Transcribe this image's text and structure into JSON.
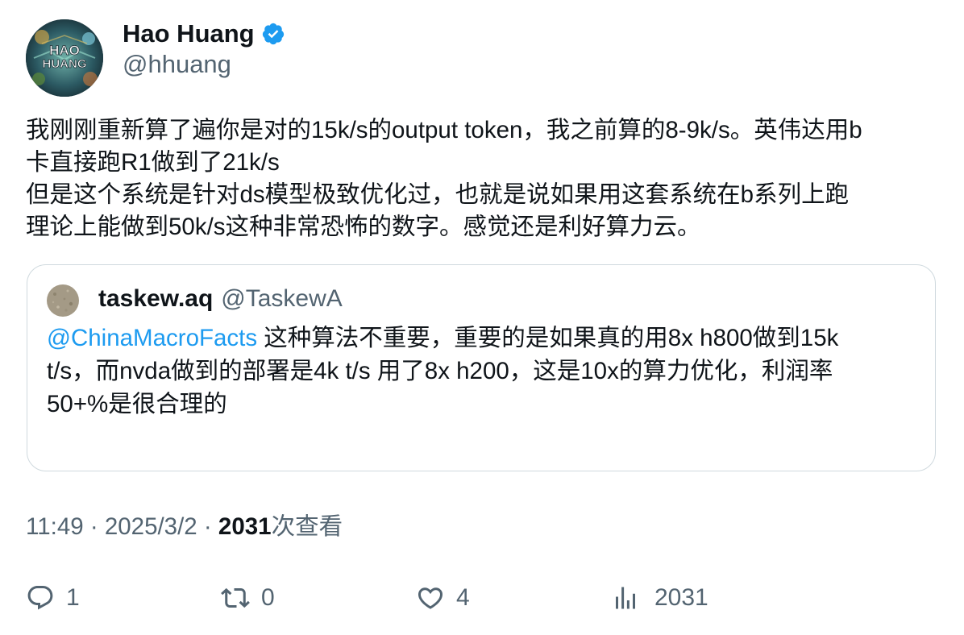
{
  "author": {
    "name": "Hao Huang",
    "handle": "@hhuang",
    "avatar_text_line1": "HAO",
    "avatar_text_line2": "HUANG"
  },
  "tweet": {
    "lines": [
      "我刚刚重新算了遍你是对的15k/s的output token，我之前算的8-9k/s。英伟达用b",
      "卡直接跑R1做到了21k/s",
      "但是这个系统是针对ds模型极致优化过，也就是说如果用这套系统在b系列上跑",
      "理论上能做到50k/s这种非常恐怖的数字。感觉还是利好算力云。"
    ]
  },
  "quote": {
    "name": "taskew.aq",
    "handle": "@TaskewA",
    "mention": "@ChinaMacroFacts",
    "line1_rest": " 这种算法不重要，重要的是如果真的用8x h800做到15k",
    "line2": "t/s，而nvda做到的部署是4k t/s 用了8x h200，这是10x的算力优化，利润率",
    "line3": "50+%是很合理的"
  },
  "meta": {
    "time": "11:49",
    "sep1": " · ",
    "date": "2025/3/2",
    "sep2": " · ",
    "views_count": "2031",
    "views_label": "次查看"
  },
  "actions": {
    "reply_count": "1",
    "retweet_count": "0",
    "like_count": "4",
    "views_count": "2031"
  },
  "colors": {
    "accent": "#1d9bf0",
    "secondary_text": "#536471",
    "primary_text": "#0f1419",
    "border": "#cfd9de"
  }
}
